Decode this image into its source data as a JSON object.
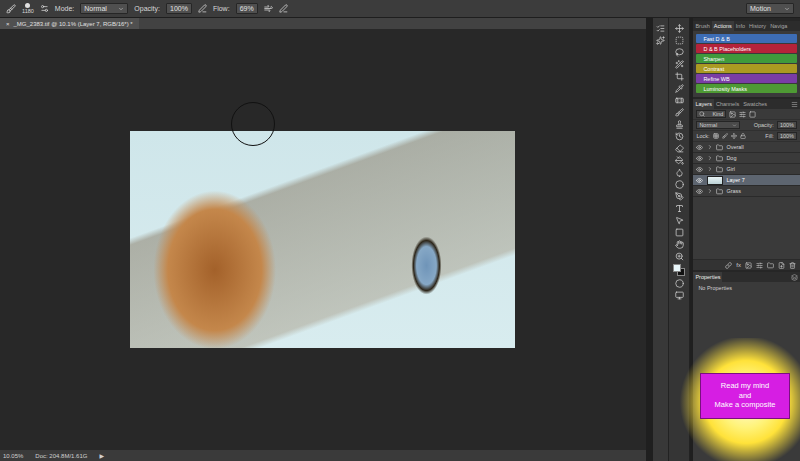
{
  "window": {
    "title": "_MG_2383.tif @ 10.1% (Layer 7, RGB/16*) *",
    "close": "×"
  },
  "options_bar": {
    "brush_size": "1180",
    "mode_label": "Mode:",
    "mode": "Normal",
    "opacity_label": "Opacity:",
    "opacity": "100%",
    "flow_label": "Flow:",
    "flow": "69%",
    "workspace": "Motion"
  },
  "panel_tabs": [
    {
      "label": "Brush",
      "selected": false
    },
    {
      "label": "Actions",
      "selected": true
    },
    {
      "label": "Info",
      "selected": false
    },
    {
      "label": "History",
      "selected": false
    },
    {
      "label": "Naviga",
      "selected": false
    }
  ],
  "actions": [
    {
      "name": "Fast D & B",
      "color": "#3d6db5"
    },
    {
      "name": "D & B Placeholders",
      "color": "#b5233a"
    },
    {
      "name": "Sharpen",
      "color": "#3f9a3c"
    },
    {
      "name": "Contrast",
      "color": "#ab9a22"
    },
    {
      "name": "Refine WB",
      "color": "#7a3da6"
    },
    {
      "name": "Luminosity Masks",
      "color": "#4e9a34"
    }
  ],
  "layers_tabs": [
    {
      "label": "Layers",
      "selected": true
    },
    {
      "label": "Channels",
      "selected": false
    },
    {
      "label": "Swatches",
      "selected": false
    }
  ],
  "layers_controls": {
    "filter": "Kind",
    "blend": "Normal",
    "opacity_label": "Opacity:",
    "opacity": "100%",
    "lock_label": "Lock:",
    "fill_label": "Fill:",
    "fill": "100%",
    "fx": "fx"
  },
  "layers": [
    {
      "name": "Overall",
      "kind": "group",
      "visible": true,
      "expanded": false,
      "selected": false
    },
    {
      "name": "Dog",
      "kind": "group",
      "visible": true,
      "expanded": false,
      "selected": false
    },
    {
      "name": "Girl",
      "kind": "group",
      "visible": true,
      "expanded": false,
      "selected": false
    },
    {
      "name": "Layer 7",
      "kind": "layer",
      "visible": true,
      "expanded": false,
      "selected": true
    },
    {
      "name": "Grass",
      "kind": "group",
      "visible": true,
      "expanded": false,
      "selected": false
    }
  ],
  "properties": {
    "title": "Properties",
    "message": "No Properties"
  },
  "status_bar": {
    "zoom": "10.05%",
    "doc": "Doc: 204.8M/1.61G",
    "arrow": "▶"
  },
  "callout": {
    "lines": [
      "Read my mind",
      "and",
      "Make a composite"
    ]
  }
}
